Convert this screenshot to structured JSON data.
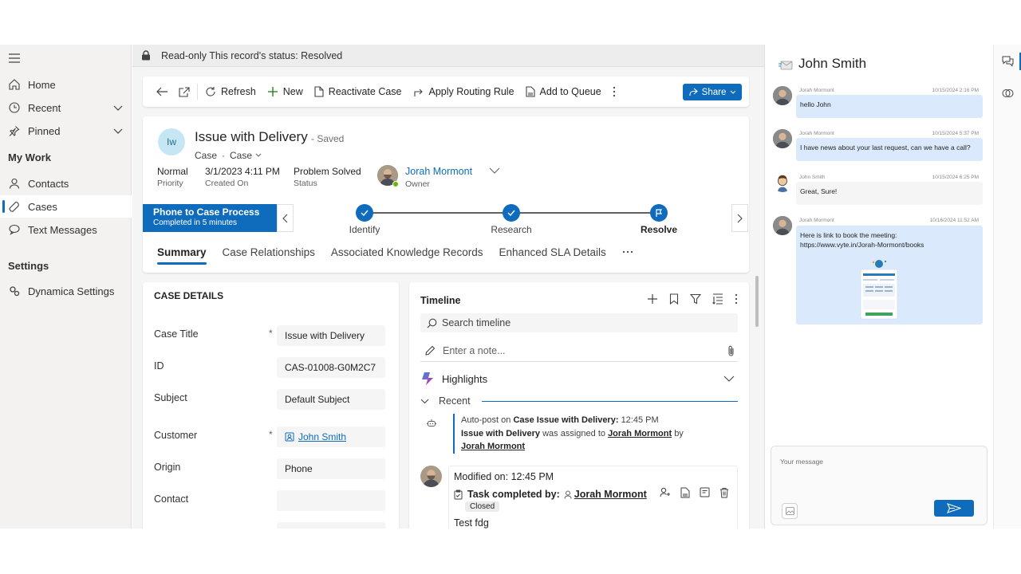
{
  "nav": {
    "items": [
      {
        "label": "Home",
        "icon": "home-icon"
      },
      {
        "label": "Recent",
        "icon": "clock-icon"
      },
      {
        "label": "Pinned",
        "icon": "pin-icon"
      }
    ],
    "my_work": "My Work",
    "work_items": [
      {
        "label": "Contacts",
        "icon": "person-icon"
      },
      {
        "label": "Cases",
        "icon": "wrench-icon"
      },
      {
        "label": "Text Messages",
        "icon": "chat-icon"
      }
    ],
    "settings": "Settings",
    "settings_items": [
      {
        "label": "Dynamica Settings",
        "icon": "gears-icon"
      }
    ]
  },
  "banner": {
    "text": "Read-only This record's status: Resolved"
  },
  "toolbar": {
    "refresh": "Refresh",
    "new": "New",
    "reactivate": "Reactivate Case",
    "routing": "Apply Routing Rule",
    "queue": "Add to Queue",
    "share": "Share"
  },
  "record": {
    "initials": "Iw",
    "title": "Issue with Delivery",
    "saved": "- Saved",
    "entity": "Case",
    "form": "Case",
    "priority": {
      "value": "Normal",
      "label": "Priority"
    },
    "created": {
      "value": "3/1/2023 4:11 PM",
      "label": "Created On"
    },
    "status": {
      "value": "Problem Solved",
      "label": "Status"
    },
    "owner": {
      "value": "Jorah Mormont",
      "label": "Owner"
    }
  },
  "bpf": {
    "name": "Phone to Case Process",
    "sub": "Completed in 5 minutes",
    "stages": [
      "Identify",
      "Research",
      "Resolve"
    ]
  },
  "tabs": [
    "Summary",
    "Case Relationships",
    "Associated Knowledge Records",
    "Enhanced SLA Details"
  ],
  "case_details": {
    "title": "CASE DETAILS",
    "fields": [
      {
        "label": "Case Title",
        "value": "Issue with Delivery",
        "required": "*"
      },
      {
        "label": "ID",
        "value": "CAS-01008-G0M2C7",
        "required": ""
      },
      {
        "label": "Subject",
        "value": "Default Subject",
        "required": ""
      },
      {
        "label": "Customer",
        "value": "John Smith",
        "required": "*"
      },
      {
        "label": "Origin",
        "value": "Phone",
        "required": ""
      },
      {
        "label": "Contact",
        "value": "",
        "required": ""
      }
    ]
  },
  "timeline": {
    "title": "Timeline",
    "search_placeholder": "Search timeline",
    "note_placeholder": "Enter a note...",
    "highlights": "Highlights",
    "recent": "Recent",
    "post": {
      "prefix": "Auto-post on",
      "bold": "Case Issue with Delivery:",
      "time": "12:45 PM",
      "line2_bold": "Issue with Delivery",
      "line2_mid": "was assigned to",
      "assignee": "Jorah Mormont",
      "by": "by",
      "assigner": "Jorah Mormont"
    },
    "activity": {
      "modified": "Modified on: 12:45 PM",
      "task": "Task completed by:",
      "by": "Jorah Mormont",
      "badge": "Closed",
      "body": "Test fdg"
    }
  },
  "chat": {
    "title": "John Smith",
    "messages": [
      {
        "name": "Jorah Mormont",
        "time": "10/15/2024 2:16 PM",
        "text": "hello John",
        "style": "blue"
      },
      {
        "name": "Jorah Mormont",
        "time": "10/15/2024 5:37 PM",
        "text": "I have news about your last request, can we have a call?",
        "style": "blue"
      },
      {
        "name": "John Smith",
        "time": "10/15/2024 6:25 PM",
        "text": "Great, Sure!",
        "style": "gray"
      },
      {
        "name": "Jorah Mormont",
        "time": "10/16/2024 11:52 AM",
        "text": "Here is link to book the meeting:",
        "text2": "https://www.vyte.in/Jorah-Mormont/books",
        "style": "blue"
      }
    ],
    "placeholder": "Your message"
  }
}
